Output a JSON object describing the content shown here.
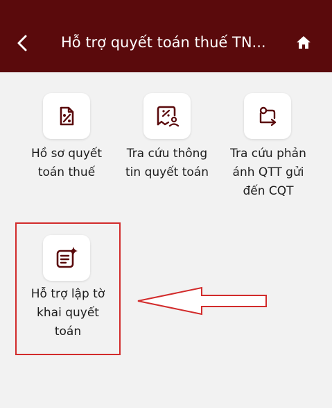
{
  "header": {
    "title": "Hỗ trợ quyết toán thuế TN...",
    "back_icon": "chevron-left-icon",
    "home_icon": "home-icon",
    "background": "#5a0a0c"
  },
  "tiles": [
    {
      "label": "Hồ sơ quyết\ntoán thuế",
      "icon": "tax-document-icon"
    },
    {
      "label": "Tra cứu thông\ntin quyết toán",
      "icon": "percent-lookup-icon"
    },
    {
      "label": "Tra cứu phản\nánh QTT gửi\nđến CQT",
      "icon": "feedback-route-icon"
    },
    {
      "label": "Hỗ trợ lập tờ\nkhai quyết\ntoán",
      "icon": "form-sparkle-icon"
    }
  ],
  "annotation": {
    "box_color": "#d22b2b",
    "arrow_icon": "left-arrow-outline-icon"
  },
  "icon_color": "#5a0a0c"
}
